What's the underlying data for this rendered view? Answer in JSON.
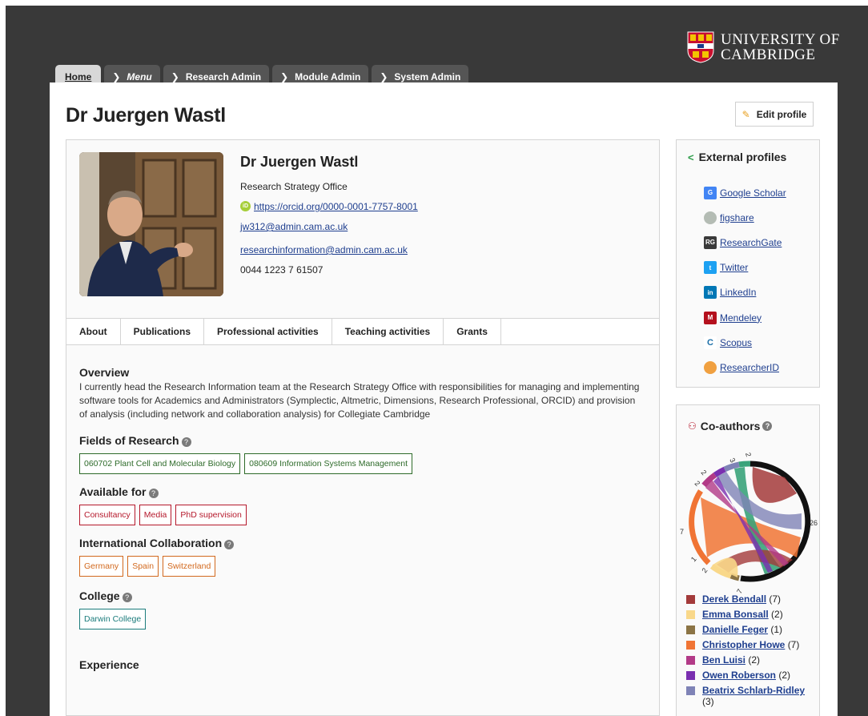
{
  "branding": {
    "university_name_line1": "UNIVERSITY OF",
    "university_name_line2": "CAMBRIDGE"
  },
  "nav_tabs": [
    {
      "label": "Home"
    },
    {
      "label": "Menu"
    },
    {
      "label": "Research Admin"
    },
    {
      "label": "Module Admin"
    },
    {
      "label": "System Admin"
    }
  ],
  "page": {
    "title": "Dr Juergen Wastl",
    "edit_label": "Edit profile"
  },
  "profile": {
    "name": "Dr Juergen Wastl",
    "department": "Research Strategy Office",
    "orcid_url": "https://orcid.org/0000-0001-7757-8001",
    "email1": "jw312@admin.cam.ac.uk",
    "email2": "researchinformation@admin.cam.ac.uk",
    "phone": "0044 1223 7 61507"
  },
  "profile_tabs": [
    "About",
    "Publications",
    "Professional activities",
    "Teaching activities",
    "Grants"
  ],
  "about": {
    "overview_heading": "Overview",
    "overview_text": "I currently head the Research Information team at the Research Strategy Office with responsibilities for managing and implementing software tools for Academics and Administrators (Symplectic, Altmetric, Dimensions, Research Professional, ORCID) and provision of analysis (including network and collaboration analysis) for Collegiate Cambridge",
    "fields_heading": "Fields of Research",
    "fields": [
      "060702 Plant Cell and Molecular Biology",
      "080609 Information Systems Management"
    ],
    "available_heading": "Available for",
    "available": [
      "Consultancy",
      "Media",
      "PhD supervision"
    ],
    "intl_heading": "International Collaboration",
    "intl": [
      "Germany",
      "Spain",
      "Switzerland"
    ],
    "college_heading": "College",
    "college": [
      "Darwin College"
    ],
    "experience_heading": "Experience"
  },
  "external_profiles": {
    "heading": "External profiles",
    "items": [
      {
        "label": "Google Scholar",
        "icon": "google-scholar-icon",
        "color": "#4285f4"
      },
      {
        "label": "figshare",
        "icon": "figshare-icon",
        "color": "#9aa39a"
      },
      {
        "label": "ResearchGate",
        "icon": "researchgate-icon",
        "color": "#3a3a3a"
      },
      {
        "label": "Twitter",
        "icon": "twitter-icon",
        "color": "#1da1f2"
      },
      {
        "label": "LinkedIn",
        "icon": "linkedin-icon",
        "color": "#0077b5"
      },
      {
        "label": "Mendeley",
        "icon": "mendeley-icon",
        "color": "#b4101d"
      },
      {
        "label": "Scopus",
        "icon": "scopus-icon",
        "color": "#1c6fa8"
      },
      {
        "label": "ResearcherID",
        "icon": "researcherid-icon",
        "color": "#f0a040"
      }
    ]
  },
  "coauthors": {
    "heading": "Co-authors",
    "chart_labels": [
      "2",
      "3",
      "2",
      "2",
      "26",
      "7",
      "1",
      "2",
      "7"
    ],
    "list": [
      {
        "name": "Derek Bendall",
        "count": "(7)",
        "color": "#a33a3a"
      },
      {
        "name": "Emma Bonsall",
        "count": "(2)",
        "color": "#f9d88a"
      },
      {
        "name": "Danielle Feger",
        "count": "(1)",
        "color": "#8b7445"
      },
      {
        "name": "Christopher Howe",
        "count": "(7)",
        "color": "#f07434"
      },
      {
        "name": "Ben Luisi",
        "count": "(2)",
        "color": "#b23a87"
      },
      {
        "name": "Owen Roberson",
        "count": "(2)",
        "color": "#7a2fb0"
      },
      {
        "name": "Beatrix Schlarb-Ridley",
        "count": "(3)",
        "color": "#7f83b6"
      }
    ]
  }
}
